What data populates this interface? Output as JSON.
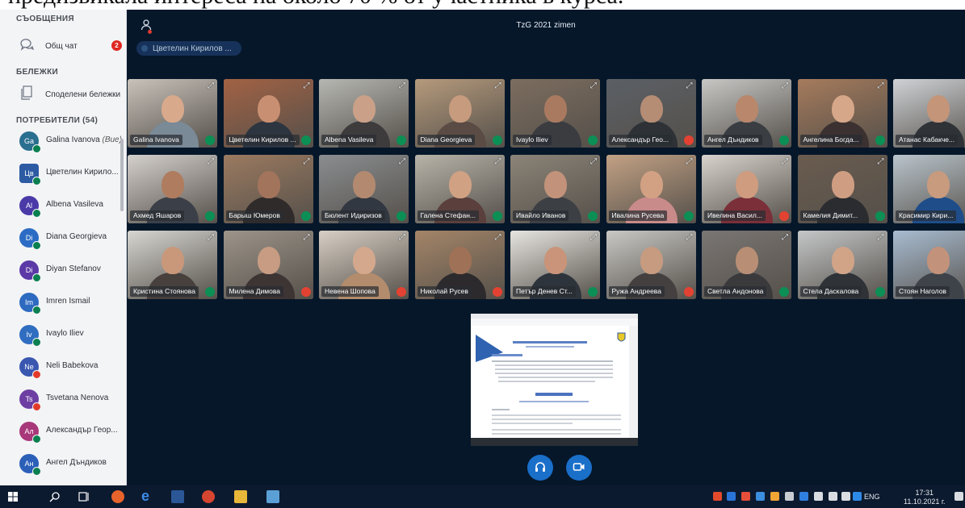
{
  "caption": "предизвикала интереса на около 70 % от участника в курса.",
  "sidebar": {
    "messages_title": "СЪОБЩЕНИЯ",
    "public_chat": "Общ чат",
    "unread_count": "2",
    "notes_title": "БЕЛЕЖКИ",
    "shared_notes": "Споделени бележки",
    "users_title": "ПОТРЕБИТЕЛИ (54)",
    "users": [
      {
        "initials": "Ga",
        "name": "Galina Ivanova",
        "suffix": "(Вие)",
        "color": "#2a6f8f",
        "status": "on",
        "square": false
      },
      {
        "initials": "Цв",
        "name": "Цветелин Кирило...",
        "suffix": "",
        "color": "#2c5ba3",
        "status": "on",
        "square": true
      },
      {
        "initials": "Al",
        "name": "Albena Vasileva",
        "suffix": "",
        "color": "#4a3aa8",
        "status": "on",
        "square": false
      },
      {
        "initials": "Di",
        "name": "Diana Georgieva",
        "suffix": "",
        "color": "#2c6cc4",
        "status": "on",
        "square": false
      },
      {
        "initials": "Di",
        "name": "Diyan Stefanov",
        "suffix": "",
        "color": "#5b39a6",
        "status": "on",
        "square": false
      },
      {
        "initials": "Im",
        "name": "Imren Ismail",
        "suffix": "",
        "color": "#2d6ac0",
        "status": "on",
        "square": false
      },
      {
        "initials": "Iv",
        "name": "Ivaylo Iliev",
        "suffix": "",
        "color": "#2f6dc0",
        "status": "on",
        "square": false
      },
      {
        "initials": "Ne",
        "name": "Neli Babekova",
        "suffix": "",
        "color": "#3a57b0",
        "status": "off",
        "square": false
      },
      {
        "initials": "Ts",
        "name": "Tsvetana Nenova",
        "suffix": "",
        "color": "#6d3fa3",
        "status": "off",
        "square": false
      },
      {
        "initials": "Ал",
        "name": "Александър Геор...",
        "suffix": "",
        "color": "#a8387a",
        "status": "on",
        "square": false
      },
      {
        "initials": "Ан",
        "name": "Ангел Дъндиков",
        "suffix": "",
        "color": "#2b5fb8",
        "status": "on",
        "square": false
      }
    ]
  },
  "meeting": {
    "title": "TzG 2021 zimen",
    "presenter": "Цветелин Кирилов ...",
    "tiles": [
      {
        "name": "Galina Ivanova",
        "mic": "on",
        "bg": "#c9c2bb",
        "skin": "#d9a98c",
        "shirt": "#7a8a96"
      },
      {
        "name": "Цветелин Кирилов ...",
        "mic": "on",
        "bg": "#a26244",
        "skin": "#c98f72",
        "shirt": "#2c3540"
      },
      {
        "name": "Albena Vasileva",
        "mic": "on",
        "bg": "#b6b7b2",
        "skin": "#caa188",
        "shirt": "#3d3b3c"
      },
      {
        "name": "Diana Georgieva",
        "mic": "on",
        "bg": "#b59a7c",
        "skin": "#c79b7e",
        "shirt": "#5a4b44"
      },
      {
        "name": "Ivaylo Iliev",
        "mic": "on",
        "bg": "#7c6d5f",
        "skin": "#a97a60",
        "shirt": "#3a3c40"
      },
      {
        "name": "Александър Гео...",
        "mic": "off",
        "bg": "#5b6066",
        "skin": "#b58c74",
        "shirt": "#2e3236"
      },
      {
        "name": "Ангел Дъндиков",
        "mic": "on",
        "bg": "#c7c7c5",
        "skin": "#b8876c",
        "shirt": "#3a3d42"
      },
      {
        "name": "Ангелина Богда...",
        "mic": "on",
        "bg": "#a67b5c",
        "skin": "#d7a789",
        "shirt": "#3b3130"
      },
      {
        "name": "Атанас Кабакче...",
        "mic": "on",
        "bg": "#cfd2d6",
        "skin": "#c49579",
        "shirt": "#2f3338"
      },
      {
        "name": "Ахмед Яшаров",
        "mic": "on",
        "bg": "#d4d0cc",
        "skin": "#b07c5f",
        "shirt": "#3b4048"
      },
      {
        "name": "Барыш Юмеров",
        "mic": "on",
        "bg": "#9b7a60",
        "skin": "#a3745c",
        "shirt": "#2f2b2a"
      },
      {
        "name": "Бюлент Идиризов",
        "mic": "on",
        "bg": "#8a8d90",
        "skin": "#b38a70",
        "shirt": "#323841"
      },
      {
        "name": "Галена Стефан...",
        "mic": "on",
        "bg": "#b8b3a9",
        "skin": "#d0a183",
        "shirt": "#5a3f3c"
      },
      {
        "name": "Ивайло Иванов",
        "mic": "on",
        "bg": "#8c8478",
        "skin": "#c2927a",
        "shirt": "#3c3f44"
      },
      {
        "name": "Ивалина Русева",
        "mic": "on",
        "bg": "#c2a184",
        "skin": "#d2a184",
        "shirt": "#c98a8a"
      },
      {
        "name": "Ивелина Васил...",
        "mic": "off",
        "bg": "#d8d3cc",
        "skin": "#cf9c7f",
        "shirt": "#7b2f38"
      },
      {
        "name": "Камелия Димит...",
        "mic": "on",
        "bg": "#6a5c4f",
        "skin": "#cf9e82",
        "shirt": "#2b2c30"
      },
      {
        "name": "Красимир Кири...",
        "mic": "on",
        "bg": "#b9c4cc",
        "skin": "#c89a7e",
        "shirt": "#1e4d8a"
      },
      {
        "name": "Кристина Стоянова",
        "mic": "on",
        "bg": "#d7d6d1",
        "skin": "#c9987b",
        "shirt": "#47403d"
      },
      {
        "name": "Милена Димова",
        "mic": "off",
        "bg": "#9d948a",
        "skin": "#c79c82",
        "shirt": "#3d3434"
      },
      {
        "name": "Невена Шопова",
        "mic": "off",
        "bg": "#d8cfc5",
        "skin": "#d4a88d",
        "shirt": "#b28c6c"
      },
      {
        "name": "Николай Русев",
        "mic": "off",
        "bg": "#a48568",
        "skin": "#9f7157",
        "shirt": "#2c2a2c"
      },
      {
        "name": "Петър Денев Ст...",
        "mic": "on",
        "bg": "#e7e5e0",
        "skin": "#c99479",
        "shirt": "#2e343c"
      },
      {
        "name": "Ружа Андреева",
        "mic": "off",
        "bg": "#c9c8c4",
        "skin": "#c69b80",
        "shirt": "#444040"
      },
      {
        "name": "Светла Андонова",
        "mic": "on",
        "bg": "#7a7673",
        "skin": "#b88f75",
        "shirt": "#3a3a3d"
      },
      {
        "name": "Стела Даскалова",
        "mic": "on",
        "bg": "#c4c7c8",
        "skin": "#d1a488",
        "shirt": "#2f3338"
      },
      {
        "name": "Стоян Наголов",
        "mic": "on",
        "bg": "#a8bcd1",
        "skin": "#c2927a",
        "shirt": "#3e434a"
      }
    ]
  },
  "controls": {
    "audio_icon": "headphones-icon",
    "video_icon": "camera-icon"
  },
  "taskbar": {
    "lang": "ENG",
    "time": "17:31",
    "date": "11.10.2021 г."
  }
}
